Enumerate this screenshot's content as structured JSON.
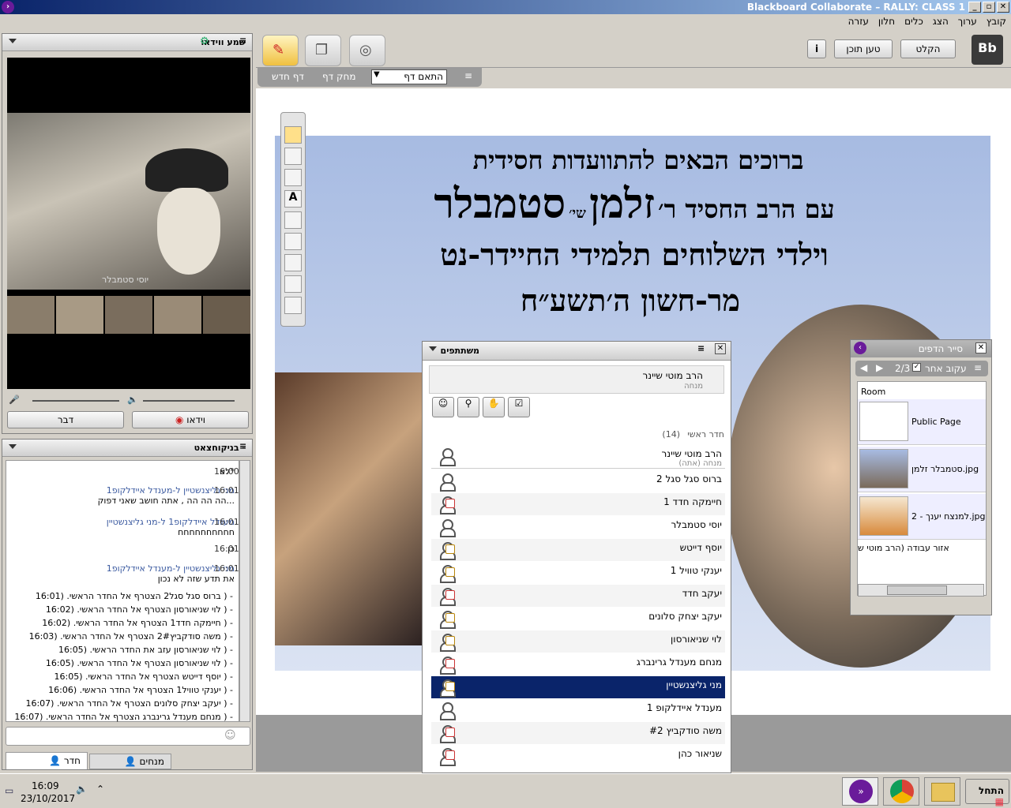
{
  "window": {
    "title": "Blackboard Collaborate – RALLY: CLASS 1",
    "controls": [
      "_",
      "▫",
      "✕"
    ]
  },
  "menu": [
    "קובץ",
    "ערוך",
    "הצג",
    "כלים",
    "חלון",
    "עזרה"
  ],
  "av_panel": {
    "title": "שמע ווידאו",
    "main_video_name": "יוסי סטמבלר",
    "talk_button": "דבר",
    "video_button": "וידאו"
  },
  "chat_panel": {
    "title": "- בניקוחצאט",
    "messages": [
      {
        "time": "16:00",
        "from": "",
        "text": "*לא"
      },
      {
        "time": "16:01",
        "from": "מני גליצנשטיין ל-מענדל איידלקופ1",
        "text": "...הה הה הה , אתה חושב שאני דפוק"
      },
      {
        "time": "16:01",
        "from": "מענדל איידלקופ1 ל-מני גליצנשטיין",
        "text": "חחחחחחחחחח"
      },
      {
        "time": "16:01",
        "from": "",
        "text": "כן"
      },
      {
        "time": "16:01",
        "from": "מני גליצנשטיין ל-מענדל איידלקופ1",
        "text": "את תדע שזה לא נכון"
      }
    ],
    "system": [
      "- ( ברוס סגל סגל2 הצטרף אל החדר הראשי. (16:01",
      "- ( לוי שניאורסון הצטרף אל החדר הראשי. (16:02",
      "- ( חיימקה חדד1 הצטרף אל החדר הראשי. (16:02",
      "- ( משה סודקביץ2# הצטרף אל החדר הראשי. (16:03",
      "- ( לוי שניאורסון עזב את החדר הראשי. (16:05",
      "- ( לוי שניאורסון הצטרף אל החדר הראשי. (16:05",
      "- ( יוסף דייטש הצטרף אל החדר הראשי. (16:05",
      "- ( יענקי טוויל1 הצטרף אל החדר הראשי. (16:06",
      "- ( יעקב יצחק סלונים הצטרף אל החדר הראשי. (16:07",
      "- ( מנחם מענדל גרינברג הצטרף אל החדר הראשי. (16:07"
    ],
    "tab_room": "חדר",
    "tab_moderators": "מנחים"
  },
  "toolbar": {
    "record": "הקלט",
    "load_content": "טען תוכן",
    "info": "i",
    "new_page": "דף חדש",
    "delete_page": "מחק דף",
    "fit_page": "התאם דף"
  },
  "slide": {
    "line1": "ברוכים הבאים להתוועדות חסידית",
    "line2a": "עם הרב החסיד ר׳",
    "line2b": "זלמן",
    "line2c": "שי׳",
    "line2d": "סטמבלר",
    "line3": "וילדי השלוחים תלמידי החיידר-נט",
    "line4": "מר-חשון ה׳תשע״ח"
  },
  "participants": {
    "title": "משתתפים",
    "me_name": "הרב מוטי שיינר",
    "me_role": "מנחה",
    "room_label": "חדר ראשי",
    "count": "(14)",
    "list": [
      {
        "name": "הרב מוטי שיינר",
        "sub": "מנחה (אתה)"
      },
      {
        "name": "ברוס סגל סגל 2",
        "sub": ""
      },
      {
        "name": "חיימקה חדד 1",
        "sub": ""
      },
      {
        "name": "יוסי סטמבלר",
        "sub": ""
      },
      {
        "name": "יוסף דייטש",
        "sub": ""
      },
      {
        "name": "יענקי טוויל 1",
        "sub": ""
      },
      {
        "name": "יעקב חדד",
        "sub": ""
      },
      {
        "name": "יעקב יצחק סלונים",
        "sub": ""
      },
      {
        "name": "לוי שניאורסון",
        "sub": ""
      },
      {
        "name": "מנחם מענדל גרינברג",
        "sub": ""
      },
      {
        "name": "מני גליצנשטיין",
        "sub": ""
      },
      {
        "name": "מענדל איידלקופ 1",
        "sub": ""
      },
      {
        "name": "משה סודקביץ #2",
        "sub": ""
      },
      {
        "name": "שניאור כהן",
        "sub": ""
      }
    ]
  },
  "page_explorer": {
    "title": "סייר הדפים",
    "page": "2/3",
    "follow": "עקוב אחר",
    "room": "Room",
    "items": [
      "Public Page",
      "jpg.סטמבלר זלמן",
      "jpg.למנצח יענך - 2"
    ],
    "workspace": "אזור עבודה (הרב מוטי ש"
  },
  "taskbar": {
    "start": "התחל",
    "time": "16:09",
    "date": "23/10/2017"
  },
  "colors": {
    "selected_row": "#0a246a",
    "titlebar": "#0a246a",
    "slide_bg": "#9fb4dd"
  }
}
